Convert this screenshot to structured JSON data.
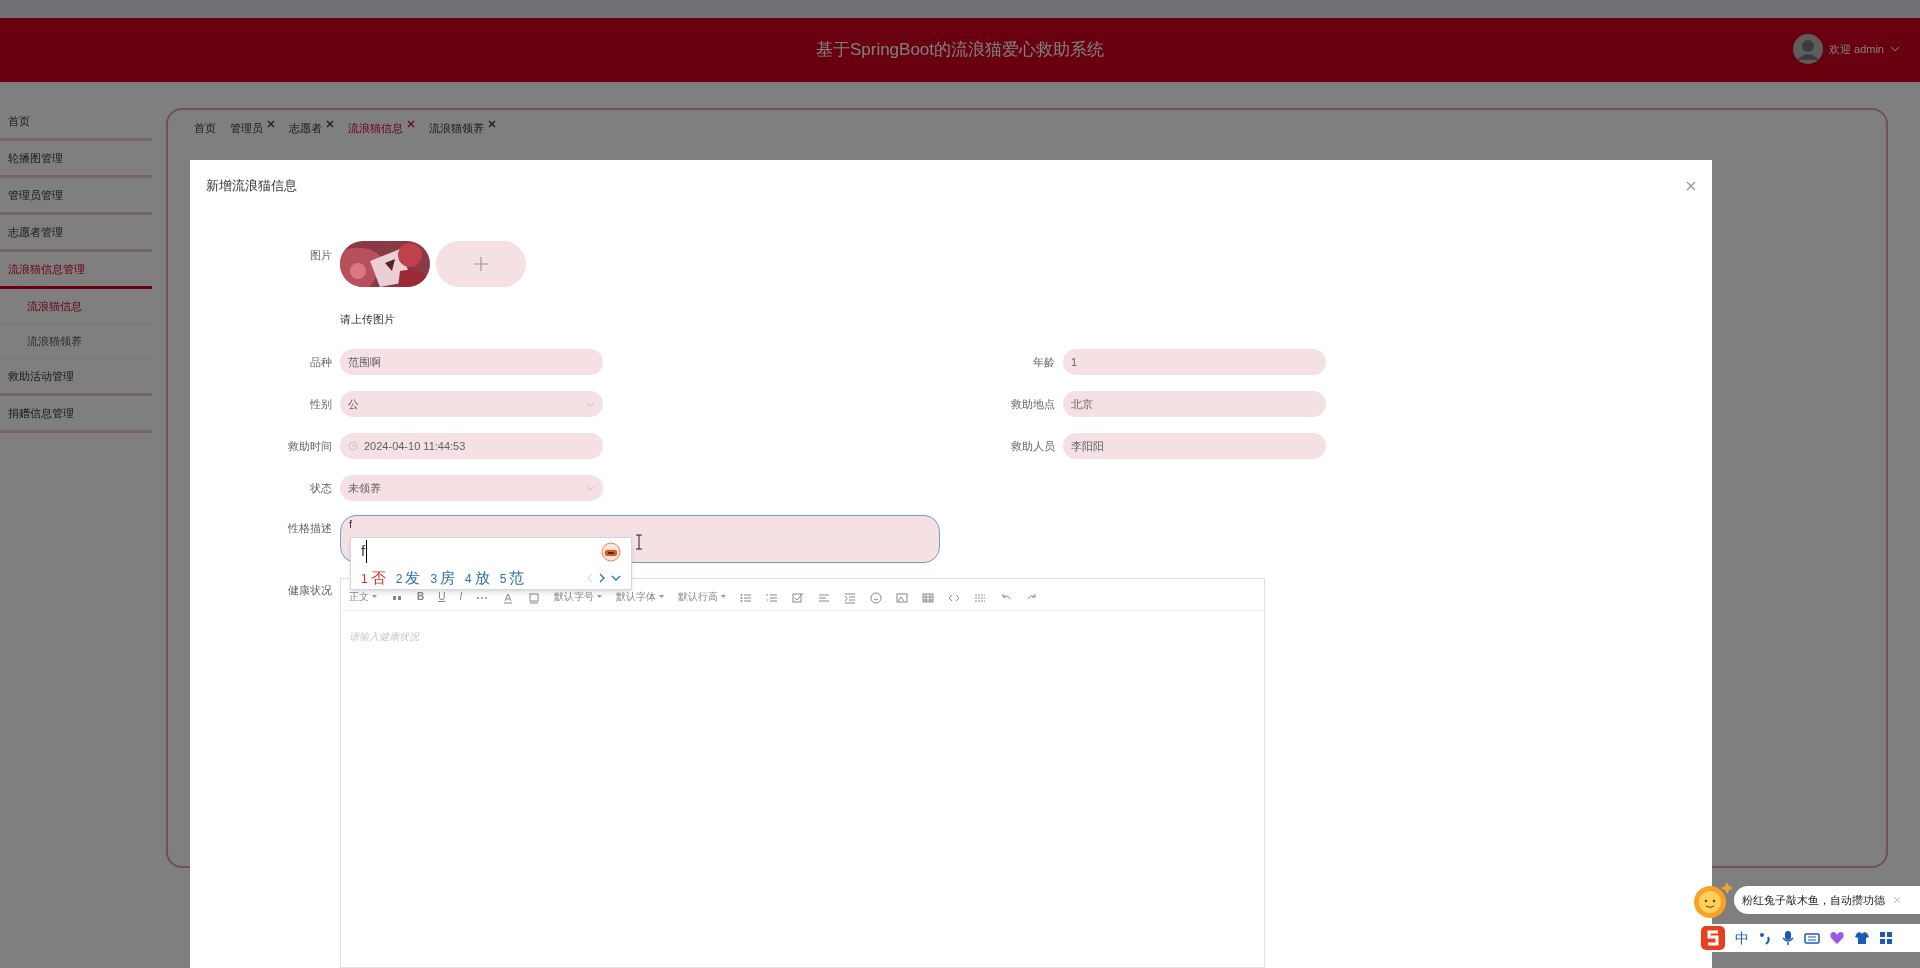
{
  "header": {
    "title": "基于SpringBoot的流浪猫爱心救助系统",
    "user": "欢迎 admin"
  },
  "sidebar": {
    "items": [
      {
        "label": "首页",
        "selected": false
      },
      {
        "label": "轮播图管理",
        "selected": false
      },
      {
        "label": "管理员管理",
        "selected": false
      },
      {
        "label": "志愿者管理",
        "selected": false
      },
      {
        "label": "流浪猫信息管理",
        "selected": true,
        "children": [
          {
            "label": "流浪猫信息",
            "selected": true
          },
          {
            "label": "流浪猫领养",
            "selected": false
          }
        ]
      },
      {
        "label": "救助活动管理",
        "selected": false
      },
      {
        "label": "捐赠信息管理",
        "selected": false
      }
    ]
  },
  "tabs": [
    {
      "label": "首页",
      "closable": false,
      "selected": false
    },
    {
      "label": "管理员",
      "closable": true,
      "selected": false
    },
    {
      "label": "志愿者",
      "closable": true,
      "selected": false
    },
    {
      "label": "流浪猫信息",
      "closable": true,
      "selected": true
    },
    {
      "label": "流浪猫领养",
      "closable": true,
      "selected": false
    }
  ],
  "dialog": {
    "title": "新增流浪猫信息",
    "image": {
      "label": "图片",
      "hint": "请上传图片"
    },
    "rows": [
      [
        {
          "label": "品种",
          "kind": "text",
          "value": "范围啊"
        },
        {
          "label": "年龄",
          "kind": "text",
          "value": "1"
        }
      ],
      [
        {
          "label": "性别",
          "kind": "select",
          "value": "公"
        },
        {
          "label": "救助地点",
          "kind": "text",
          "value": "北京"
        }
      ],
      [
        {
          "label": "救助时间",
          "kind": "datetime",
          "value": "2024-04-10 11:44:53"
        },
        {
          "label": "救助人员",
          "kind": "text",
          "value": "李阳阳"
        }
      ],
      [
        {
          "label": "状态",
          "kind": "select",
          "value": "未领养"
        }
      ]
    ],
    "description": {
      "label": "性格描述",
      "value": "f",
      "focused": true
    },
    "editor": {
      "label": "健康状况",
      "block": "正文",
      "marks": [
        "B",
        "U",
        "I"
      ],
      "dropdowns": [
        "默认字号",
        "默认字体",
        "默认行高"
      ],
      "placeholder": "请输入健康状况"
    }
  },
  "ime": {
    "input": "f",
    "candidates": [
      {
        "index": "1",
        "text": "否",
        "selected": true
      },
      {
        "index": "2",
        "text": "发",
        "selected": false
      },
      {
        "index": "3",
        "text": "房",
        "selected": false
      },
      {
        "index": "4",
        "text": "放",
        "selected": false
      },
      {
        "index": "5",
        "text": "范",
        "selected": false
      }
    ]
  },
  "notification": {
    "text": "粉红兔子敲木鱼，自动攒功德"
  },
  "ime_toolbar": {
    "mode": "中"
  }
}
